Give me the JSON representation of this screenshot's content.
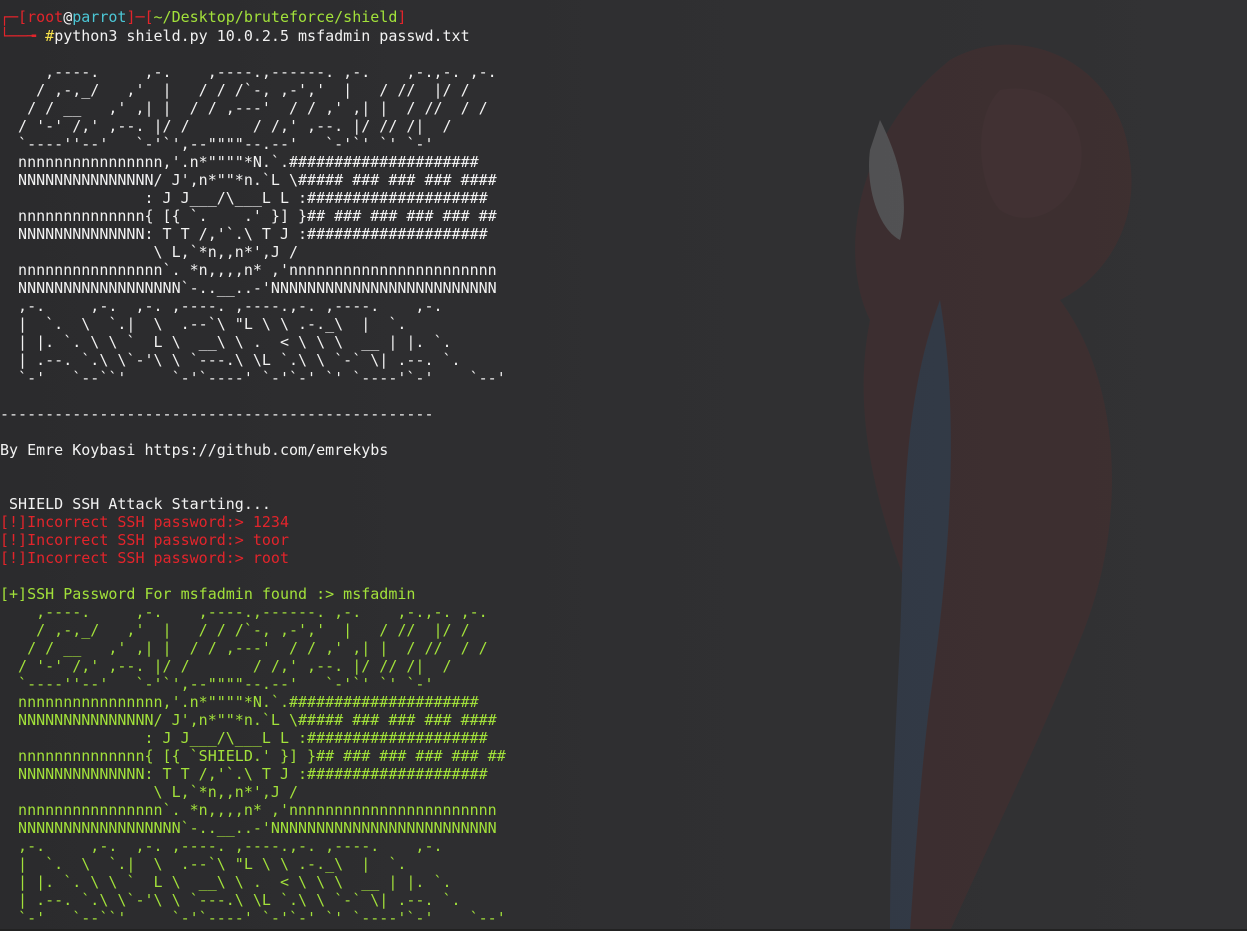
{
  "prompt": {
    "user": "root",
    "at": "@",
    "host": "parrot",
    "path": "~/Desktop/bruteforce/shield",
    "corner_top": "┌─[",
    "mid": "]─[",
    "close": "]",
    "corner_bottom": "└──╼ ",
    "hash": "#",
    "command": "python3 shield.py 10.0.2.5 msfadmin passwd.txt"
  },
  "banner_lines": [
    "     ,----.     ,-.    ,----.,------. ,-.    ,-.,-. ,-.",
    "    / ,-,_/   ,'  |   / / /`-, ,-','  |   / //  |/ /",
    "   / / __   ,' ,| |  / / ,---'  / / ,' ,| |  / //  / /",
    "  / '-' /,' ,--. |/ /       / /,' ,--. |/ // /|  /",
    "  `----''--'   `-'`',--\"\"\"\"--.--'   `-'`' `' `-'",
    "  nnnnnnnnnnnnnnnn,'.n*\"\"\"\"*N.`.#####################",
    "  NNNNNNNNNNNNNNN/ J',n*\"\"*n.`L \\##### ### ### ### ####",
    "                : J J___/\\___L L :####################",
    "  nnnnnnnnnnnnnn{ [{ `.    .' }] }## ### ### ### ### ##",
    "  NNNNNNNNNNNNNN: T T /,'`.\\ T J :####################",
    "                 \\ L,`*n,,n*',J /",
    "  nnnnnnnnnnnnnnnn`. *n,,,,n* ,'nnnnnnnnnnnnnnnnnnnnnnn",
    "  NNNNNNNNNNNNNNNNNN`-..__..-'NNNNNNNNNNNNNNNNNNNNNNNNN",
    "  ,-.     ,-.  ,-. ,----. ,----.,-. ,----.    ,-.",
    "  |  `.  \\  `.|  \\  .--`\\ \"L \\ \\ .-._\\  |  `.",
    "  | |. `. \\ \\ `  L \\  __\\ \\ .  < \\ \\ \\  __ | |. `.",
    "  | .--. `.\\ \\`-'\\ \\ `---.\\ \\L `.\\ \\ `-` \\| .--. `.",
    "  `-'   `--``'     `-'`----' `-'`-' `' `----'`-'    `--'"
  ],
  "banner_green_lines": [
    "    ,----.     ,-.    ,----.,------. ,-.    ,-.,-. ,-.",
    "    / ,-,_/   ,'  |   / / /`-, ,-','  |   / //  |/ /",
    "   / / __   ,' ,| |  / / ,---'  / / ,' ,| |  / //  / /",
    "  / '-' /,' ,--. |/ /       / /,' ,--. |/ // /|  /",
    "  `----''--'   `-'`',--\"\"\"\"--.--'   `-'`' `' `-'",
    "  nnnnnnnnnnnnnnnn,'.n*\"\"\"\"*N.`.#####################",
    "  NNNNNNNNNNNNNNN/ J',n*\"\"*n.`L \\##### ### ### ### ####",
    "                : J J___/\\___L L :####################",
    "  nnnnnnnnnnnnnn{ [{ `SHIELD.' }] }## ### ### ### ### ##",
    "  NNNNNNNNNNNNNN: T T /,'`.\\ T J :####################",
    "                 \\ L,`*n,,n*',J /",
    "  nnnnnnnnnnnnnnnn`. *n,,,,n* ,'nnnnnnnnnnnnnnnnnnnnnnn",
    "  NNNNNNNNNNNNNNNNNN`-..__..-'NNNNNNNNNNNNNNNNNNNNNNNNN",
    "  ,-.     ,-.  ,-. ,----. ,----.,-. ,----.    ,-.",
    "  |  `.  \\  `.|  \\  .--`\\ \"L \\ \\ .-._\\  |  `.",
    "  | |. `. \\ \\ `  L \\  __\\ \\ .  < \\ \\ \\  __ | |. `.",
    "  | .--. `.\\ \\`-'\\ \\ `---.\\ \\L `.\\ \\ `-` \\| .--. `.",
    "  `-'   `--``'     `-'`----' `-'`-' `' `----'`-'    `--'"
  ],
  "separator": "------------------------------------------------",
  "author_line": "By Emre Koybasi https://github.com/emrekybs",
  "attack_start": " SHIELD SSH Attack Starting...",
  "failures": [
    "[!]Incorrect SSH password:> 1234",
    "[!]Incorrect SSH password:> toor",
    "[!]Incorrect SSH password:> root"
  ],
  "success": "[+]SSH Password For msfadmin found :> msfadmin",
  "colors": {
    "background": "#2d2d2f",
    "text": "#f2f2f2",
    "error": "#e2242b",
    "success": "#a2e13a",
    "host": "#4cc7d6",
    "hash": "#f5e04b"
  }
}
